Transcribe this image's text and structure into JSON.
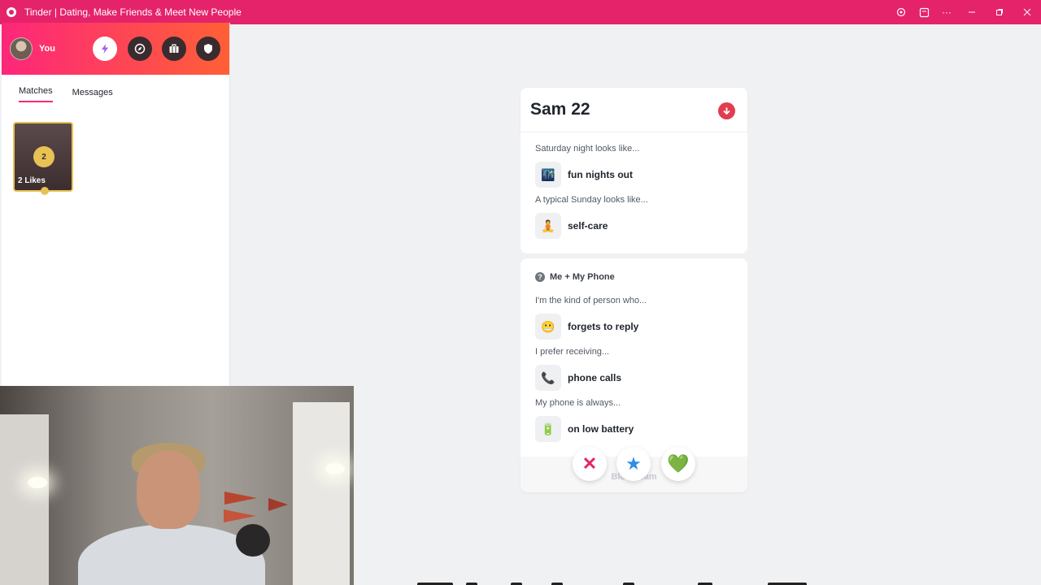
{
  "window": {
    "title": "Tinder | Dating, Make Friends & Meet New People",
    "controls": [
      "location-icon",
      "extension-icon",
      "more-icon",
      "minimize",
      "restore",
      "close"
    ]
  },
  "sidebar": {
    "user_label": "You",
    "header_buttons": [
      "bolt-icon",
      "explore-icon",
      "briefcase-icon",
      "shield-icon"
    ],
    "tabs": [
      {
        "label": "Matches",
        "active": true
      },
      {
        "label": "Messages",
        "active": false
      }
    ],
    "likes": {
      "count": "2",
      "label": "2 Likes"
    }
  },
  "profile": {
    "name_age": "Sam 22",
    "section1": {
      "items": [
        {
          "prompt": "Saturday night looks like...",
          "answer": "fun nights out",
          "icon": "🌃"
        },
        {
          "prompt": "A typical Sunday looks like...",
          "answer": "self-care",
          "icon": "🧘"
        }
      ]
    },
    "section2": {
      "title": "Me + My Phone",
      "items": [
        {
          "prompt": "I'm the kind of person who...",
          "answer": "forgets to reply",
          "icon": "😬"
        },
        {
          "prompt": "I prefer receiving...",
          "answer": "phone calls",
          "icon": "📞"
        },
        {
          "prompt": "My phone is always...",
          "answer": "on low battery",
          "icon": "🔋"
        }
      ]
    },
    "block_label": "Block Sam"
  },
  "actions": {
    "nope": "✕",
    "super_like": "★",
    "like": "💚"
  },
  "colors": {
    "titlebar": "#e5236a",
    "gradient_start": "#fd267a",
    "gradient_end": "#ff6036",
    "gold": "#e8c253"
  }
}
